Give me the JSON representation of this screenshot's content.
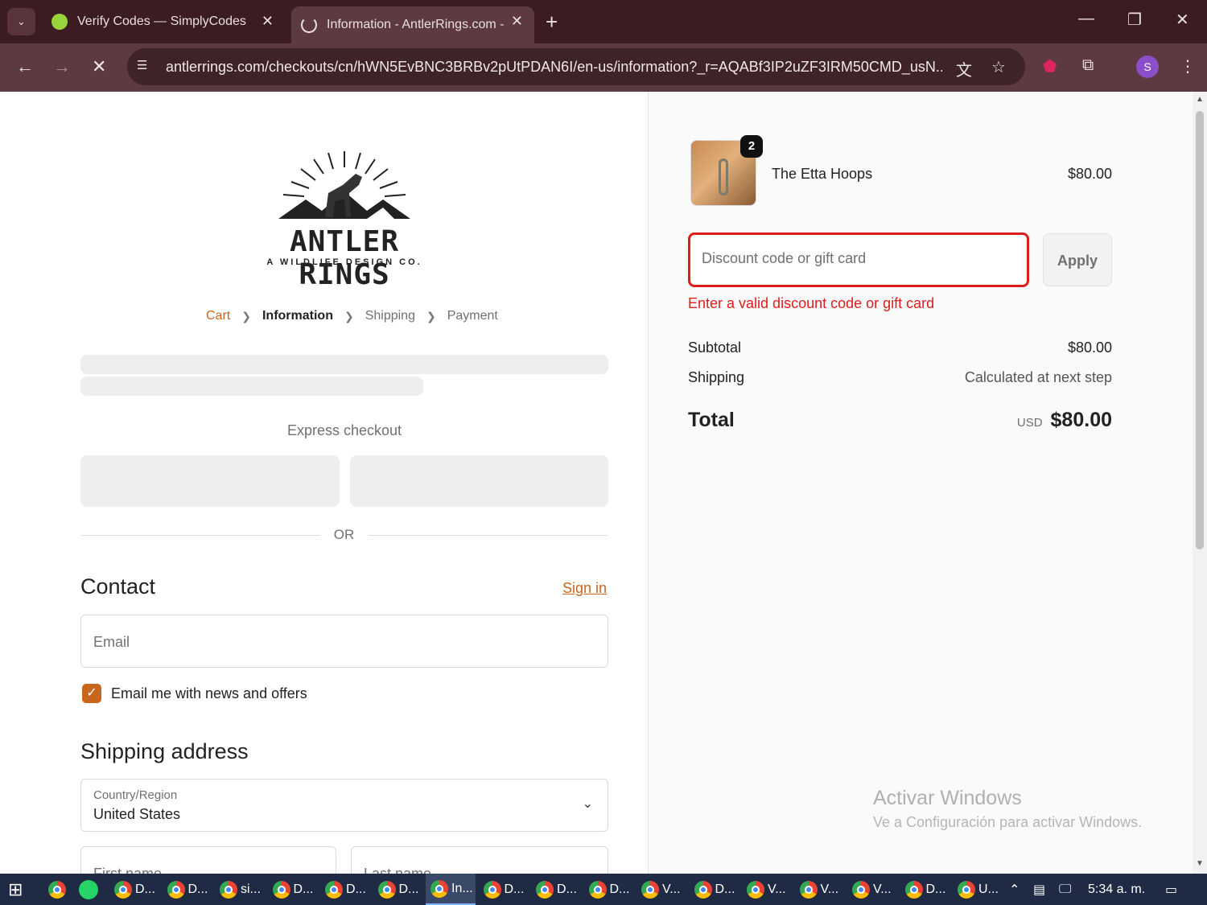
{
  "browser": {
    "tabs": [
      {
        "title": "Verify Codes — SimplyCodes",
        "active": false
      },
      {
        "title": "Information - AntlerRings.com - ",
        "active": true
      }
    ],
    "url": "antlerrings.com/checkouts/cn/hWN5EvBNC3BRBv2pUtPDAN6I/en-us/information?_r=AQABf3IP2uZF3IRM50CMD_usN...",
    "profile_initial": "S"
  },
  "store": {
    "logo_name": "ANTLER RINGS",
    "logo_tagline": "A WILDLIFE DESIGN CO."
  },
  "breadcrumbs": {
    "cart": "Cart",
    "information": "Information",
    "shipping": "Shipping",
    "payment": "Payment"
  },
  "checkout": {
    "express_label": "Express checkout",
    "or_label": "OR",
    "contact_heading": "Contact",
    "sign_in": "Sign in",
    "email_placeholder": "Email",
    "marketing_optin": "Email me with news and offers",
    "marketing_checked": true,
    "shipping_heading": "Shipping address",
    "country_label": "Country/Region",
    "country_value": "United States",
    "first_name_placeholder": "First name",
    "last_name_placeholder": "Last name"
  },
  "summary": {
    "product_name": "The Etta Hoops",
    "product_price": "$80.00",
    "quantity": "2",
    "discount_placeholder": "Discount code or gift card",
    "apply_label": "Apply",
    "discount_error": "Enter a valid discount code or gift card",
    "subtotal_label": "Subtotal",
    "subtotal_value": "$80.00",
    "shipping_label": "Shipping",
    "shipping_value": "Calculated at next step",
    "total_label": "Total",
    "total_currency": "USD",
    "total_value": "$80.00",
    "accent_color": "#c9661e",
    "error_color": "#dd1d1d"
  },
  "windows": {
    "watermark_title": "Activar Windows",
    "watermark_sub": "Ve a Configuración para activar Windows.",
    "clock": "5:34 a. m.",
    "taskbar_items": [
      "D...",
      "D...",
      "si...",
      "D...",
      "D...",
      "D...",
      "In...",
      "D...",
      "D...",
      "D...",
      "V...",
      "D...",
      "V...",
      "V...",
      "V...",
      "D...",
      "U..."
    ]
  }
}
